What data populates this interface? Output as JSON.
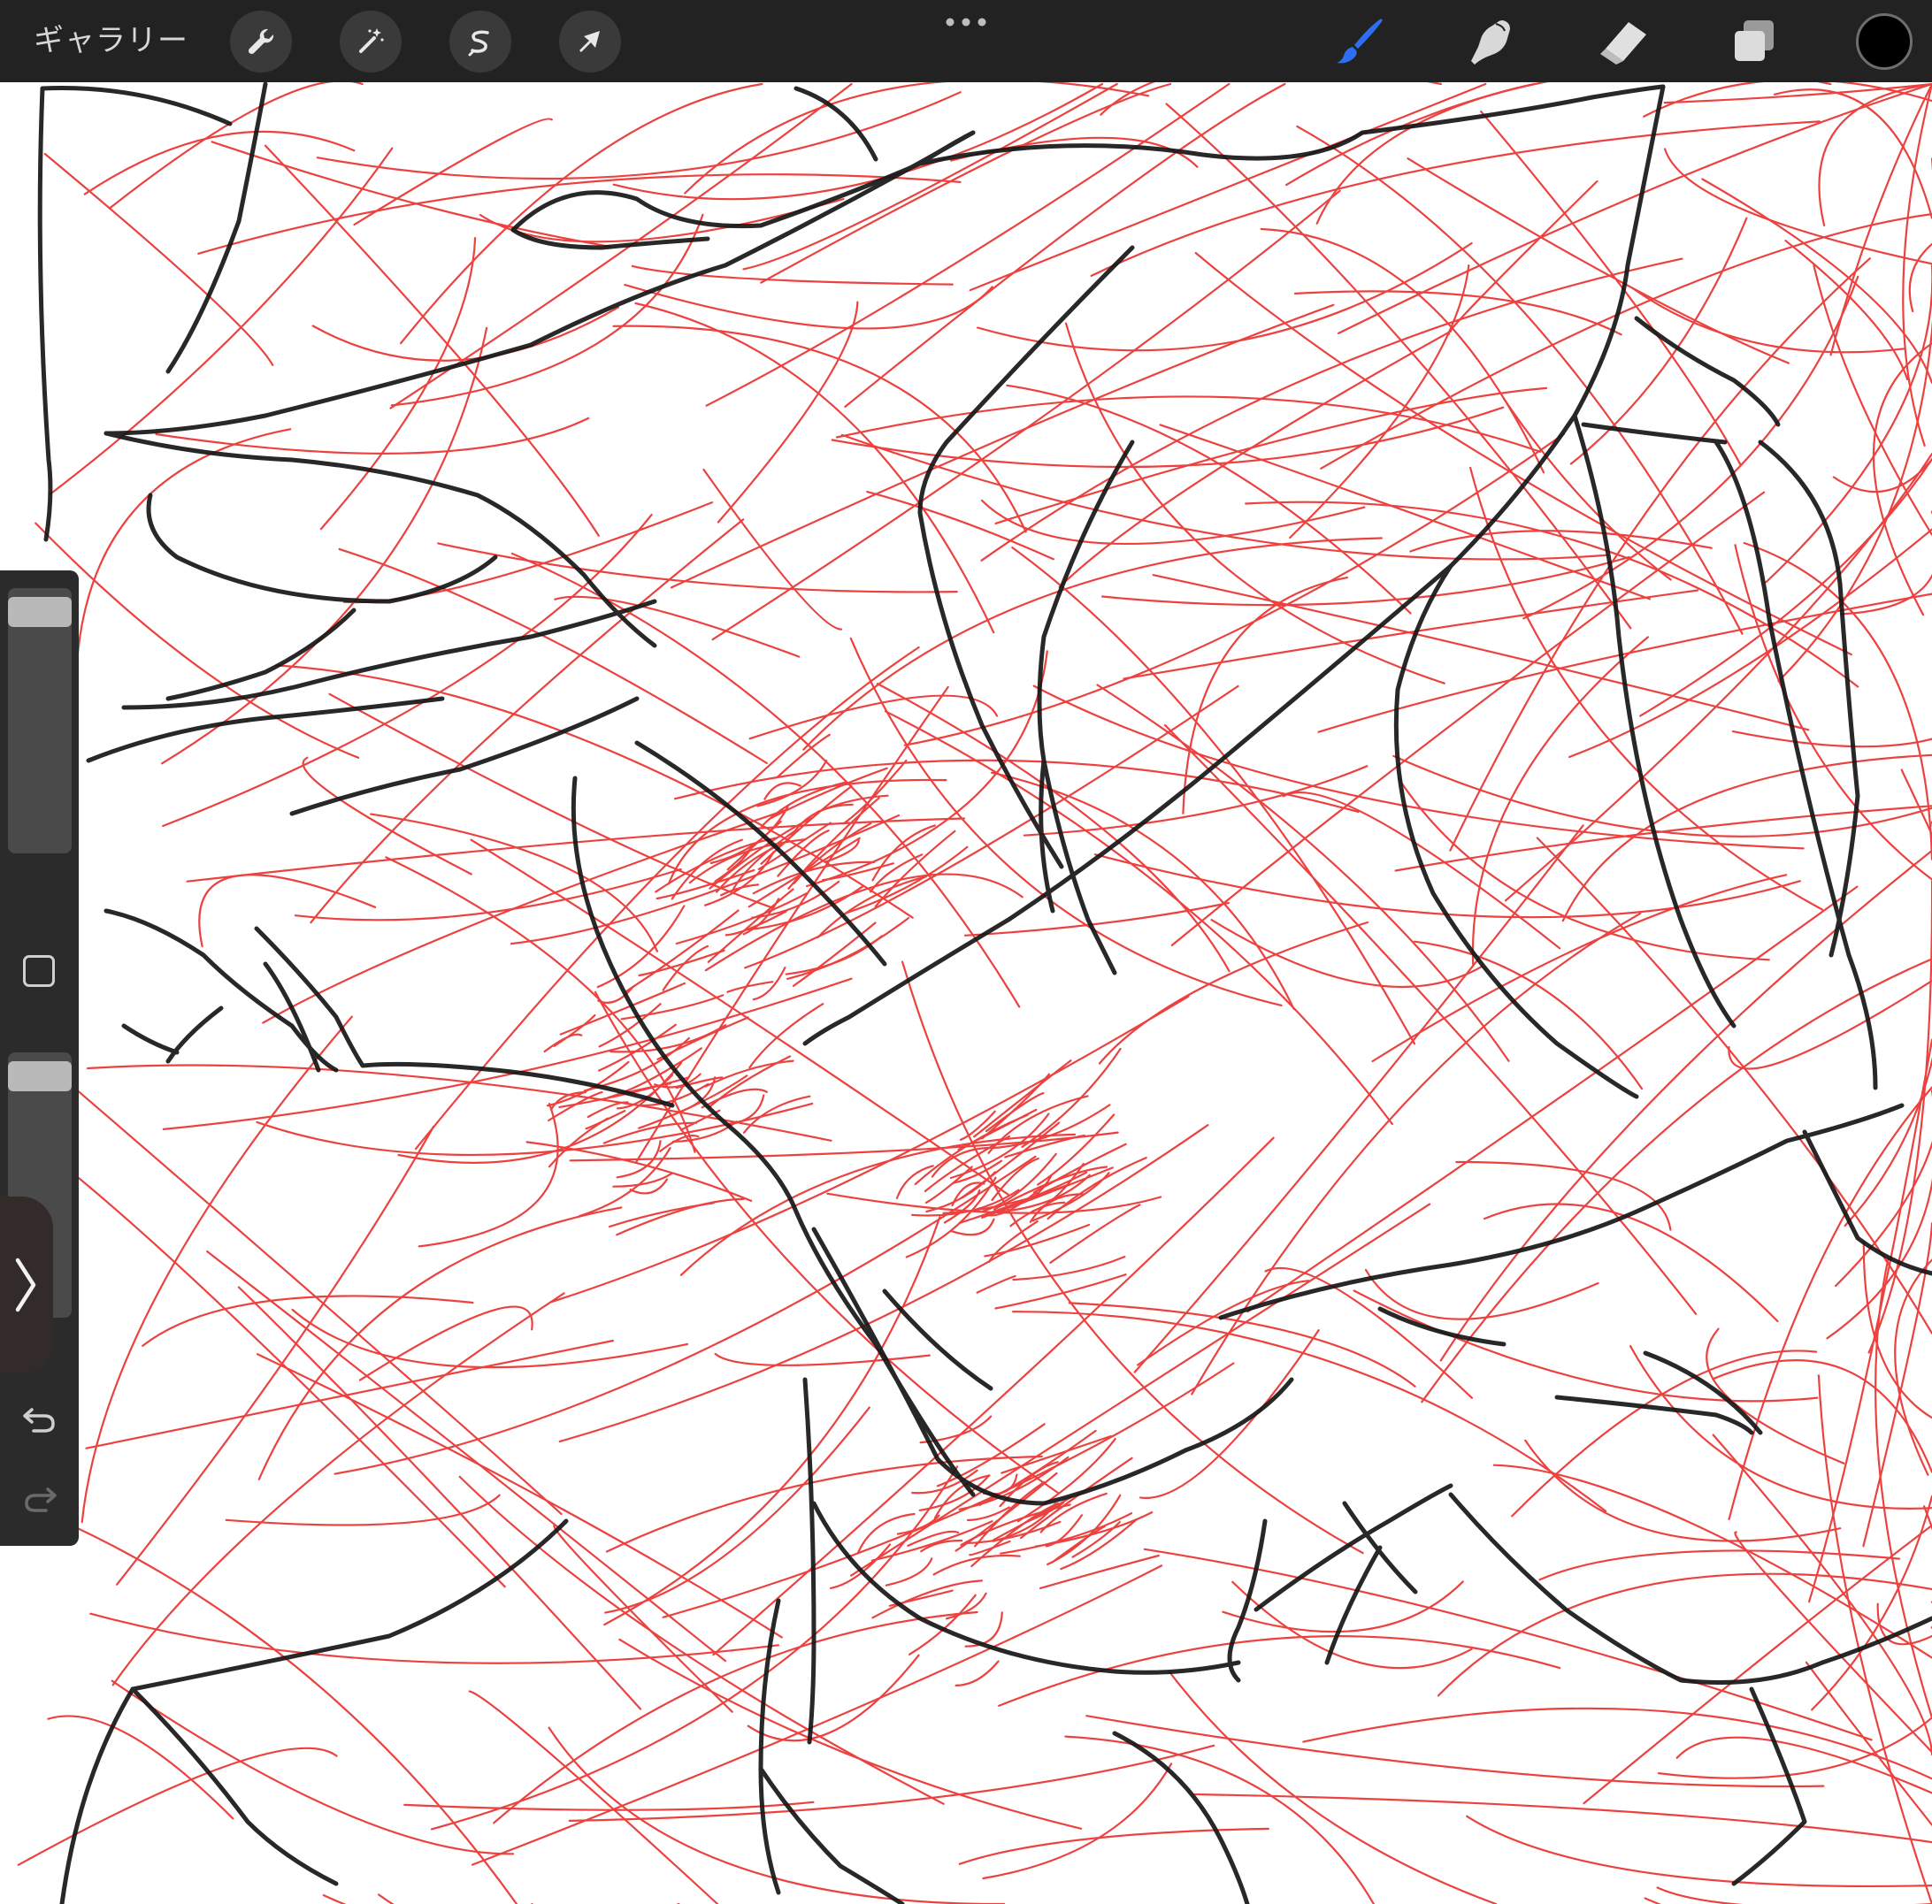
{
  "toolbar": {
    "gallery_label": "ギャラリー",
    "left_tools": [
      {
        "name": "actions",
        "icon": "wrench-icon"
      },
      {
        "name": "adjustments",
        "icon": "magic-wand-icon"
      },
      {
        "name": "selection",
        "icon": "selection-s-icon"
      },
      {
        "name": "transform",
        "icon": "arrow-cursor-icon"
      }
    ],
    "more_icon": "more-dots-icon",
    "right_tools": [
      {
        "name": "brush",
        "icon": "brush-icon",
        "active": true
      },
      {
        "name": "smudge",
        "icon": "smudge-finger-icon",
        "active": false
      },
      {
        "name": "eraser",
        "icon": "eraser-icon",
        "active": false
      },
      {
        "name": "layers",
        "icon": "layers-icon",
        "active": false
      }
    ],
    "current_color": "#000000",
    "active_tool_color": "#2e6ff2"
  },
  "sidebar": {
    "size_slider_value": 1.0,
    "opacity_slider_value": 1.0,
    "modify_icon": "square-modify-icon",
    "expand_icon": "chevron-right-icon",
    "undo_icon": "undo-icon",
    "redo_icon": "redo-icon"
  },
  "canvas": {
    "background": "#ffffff",
    "sketch_colors": {
      "rough": "#e8221f",
      "lines": "#161616"
    }
  }
}
